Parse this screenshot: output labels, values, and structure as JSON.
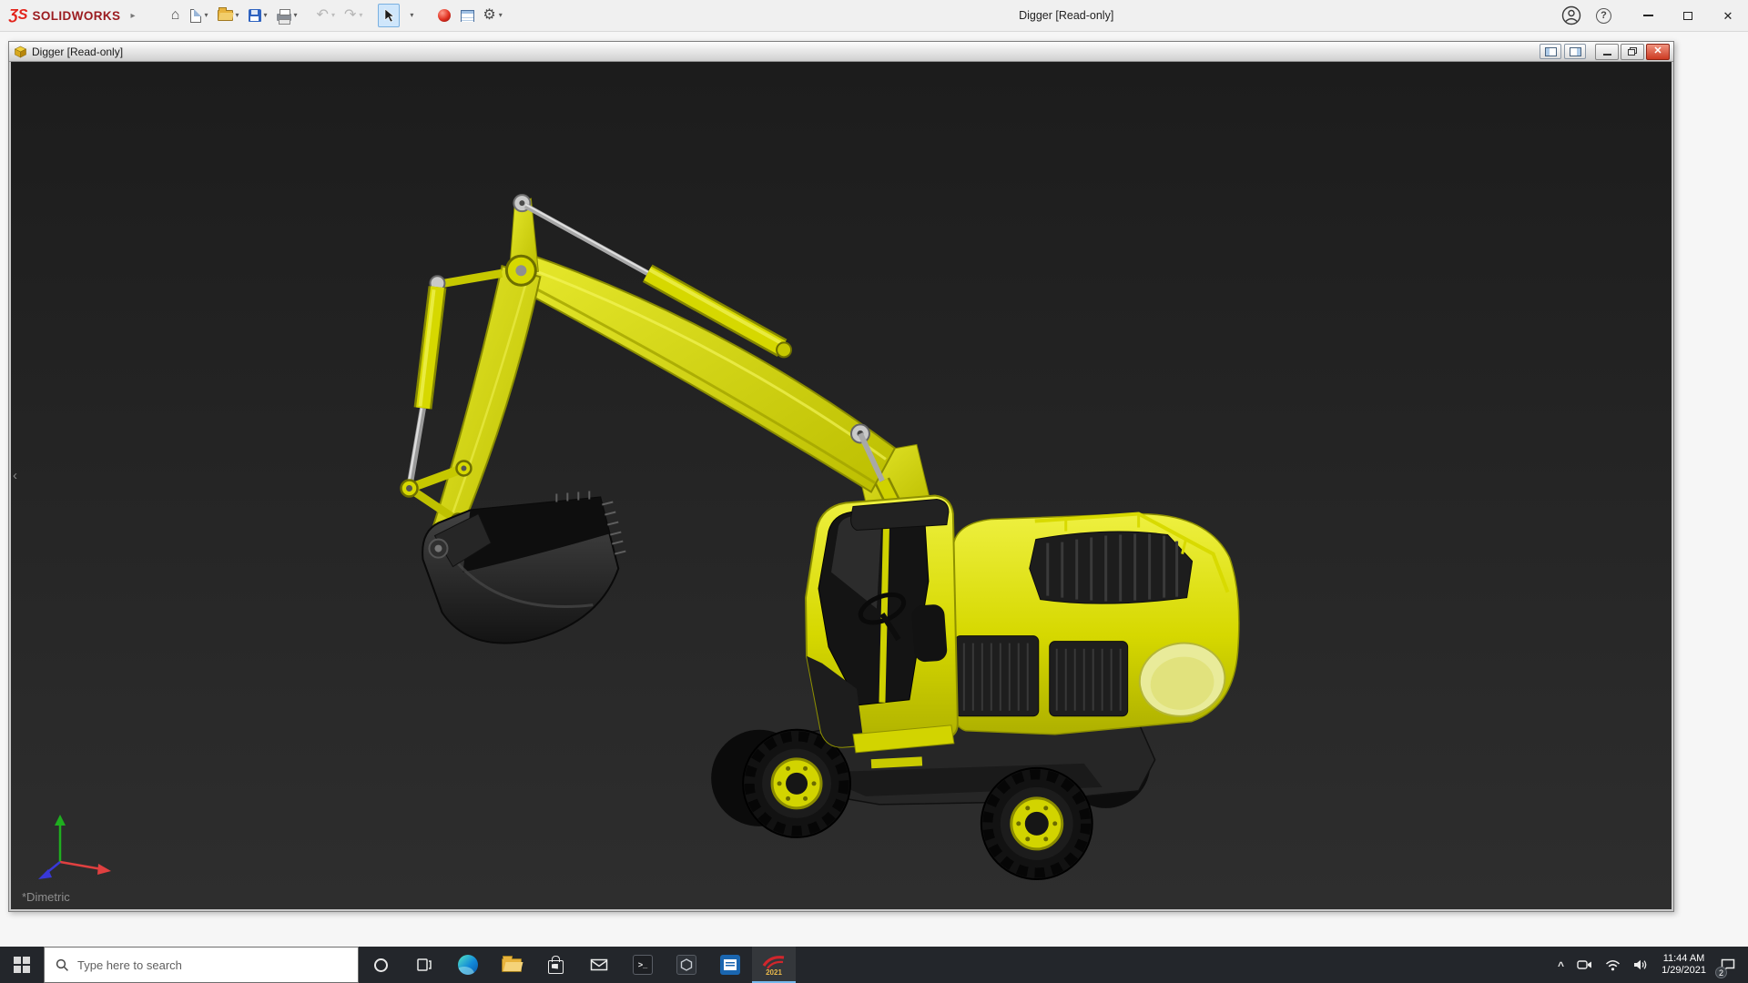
{
  "app": {
    "brand": "SOLIDWORKS",
    "logo_glyph": "ƷS",
    "brand_arrow": "▸",
    "title": "Digger [Read-only]"
  },
  "icons": {
    "home": "⌂",
    "caret": "▾",
    "undo": "↶",
    "redo": "↷",
    "gear": "⚙",
    "help": "?",
    "close": "✕",
    "collapse_arrow": "‹",
    "tray_chevron": "^",
    "terminal_glyph": ">_"
  },
  "doc": {
    "title": "Digger [Read-only]",
    "view_label": "*Dimetric"
  },
  "taskbar": {
    "search_placeholder": "Type here to search",
    "sw_year": "2021",
    "time": "11:44 AM",
    "date": "1/29/2021",
    "notification_count": "2"
  }
}
